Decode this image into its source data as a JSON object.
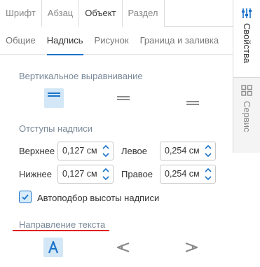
{
  "top_tabs": [
    {
      "label": "Шрифт",
      "active": false
    },
    {
      "label": "Абзац",
      "active": false
    },
    {
      "label": "Объект",
      "active": true
    },
    {
      "label": "Раздел",
      "active": false
    }
  ],
  "sub_tabs": [
    {
      "label": "Общие",
      "active": false
    },
    {
      "label": "Надпись",
      "active": true
    },
    {
      "label": "Рисунок",
      "active": false
    },
    {
      "label": "Граница и заливка",
      "active": false
    }
  ],
  "vertical_alignment": {
    "title": "Вертикальное выравнивание",
    "options": [
      {
        "name": "top",
        "active": true
      },
      {
        "name": "middle",
        "active": false
      },
      {
        "name": "bottom",
        "active": false
      }
    ]
  },
  "padding": {
    "title": "Отступы надписи",
    "top": {
      "label": "Верхнее",
      "value": "0,127 см"
    },
    "bottom": {
      "label": "Нижнее",
      "value": "0,127 см"
    },
    "left": {
      "label": "Левое",
      "value": "0,254 см"
    },
    "right": {
      "label": "Правое",
      "value": "0,254 см"
    }
  },
  "autofit": {
    "label": "Автоподбор высоты надписи",
    "checked": true
  },
  "text_direction": {
    "title": "Направление текста",
    "options": [
      {
        "name": "horizontal",
        "glyph": "A",
        "active": true
      },
      {
        "name": "rotate-up",
        "glyph": "A",
        "active": false
      },
      {
        "name": "rotate-down",
        "glyph": "A",
        "active": false
      }
    ]
  },
  "sidebar": {
    "properties_label": "Свойства",
    "service_label": "Сервис"
  },
  "colors": {
    "accent": "#1a73c9",
    "active_bg": "#d3e7f7",
    "highlight_underline": "#e01e1e"
  }
}
